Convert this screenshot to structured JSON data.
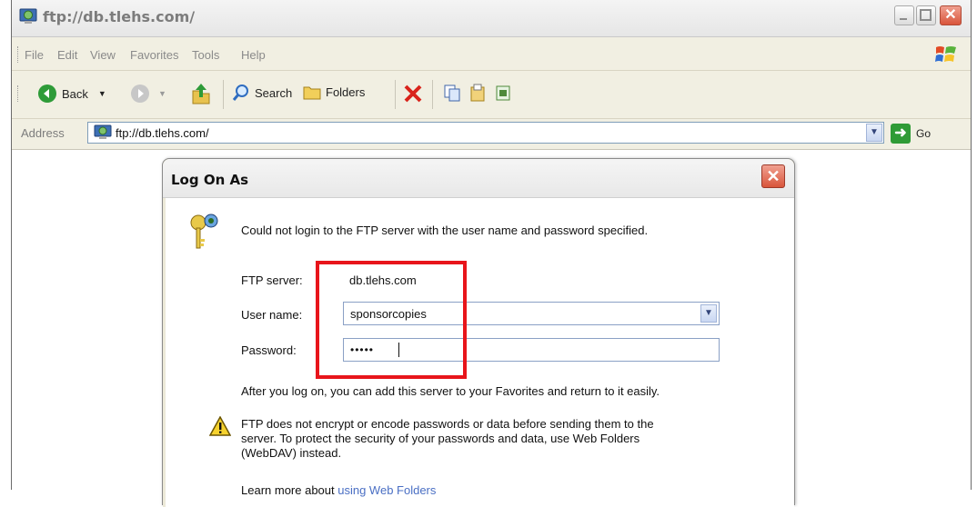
{
  "window": {
    "title": "ftp://db.tlehs.com/"
  },
  "menu": {
    "items": [
      "File",
      "Edit",
      "View",
      "Favorites",
      "Tools",
      "Help"
    ]
  },
  "toolbar": {
    "back_label": "Back",
    "search_label": "Search",
    "folders_label": "Folders"
  },
  "address": {
    "label": "Address",
    "value": "ftp://db.tlehs.com/",
    "go_label": "Go"
  },
  "dialog": {
    "title": "Log On As",
    "message": "Could not login to the FTP server with the user name and password specified.",
    "ftp_server_label": "FTP server:",
    "ftp_server_value": "db.tlehs.com",
    "username_label": "User name:",
    "username_value": "sponsorcopies",
    "password_label": "Password:",
    "password_value": "•••••",
    "favorites_note": "After you log on, you can add this server to your Favorites and return to it easily.",
    "warning_line1": "FTP does not encrypt or encode passwords or data before sending them to the",
    "warning_line2": "server.  To protect the security of your passwords and data, use Web Folders",
    "warning_line3": "(WebDAV) instead.",
    "learn_more_prefix": "Learn more about ",
    "learn_more_link": "using Web Folders"
  },
  "colors": {
    "highlight_box": "#e8151b",
    "chrome_background": "#f1efe2",
    "dialog_frame": "#ece9d8"
  }
}
